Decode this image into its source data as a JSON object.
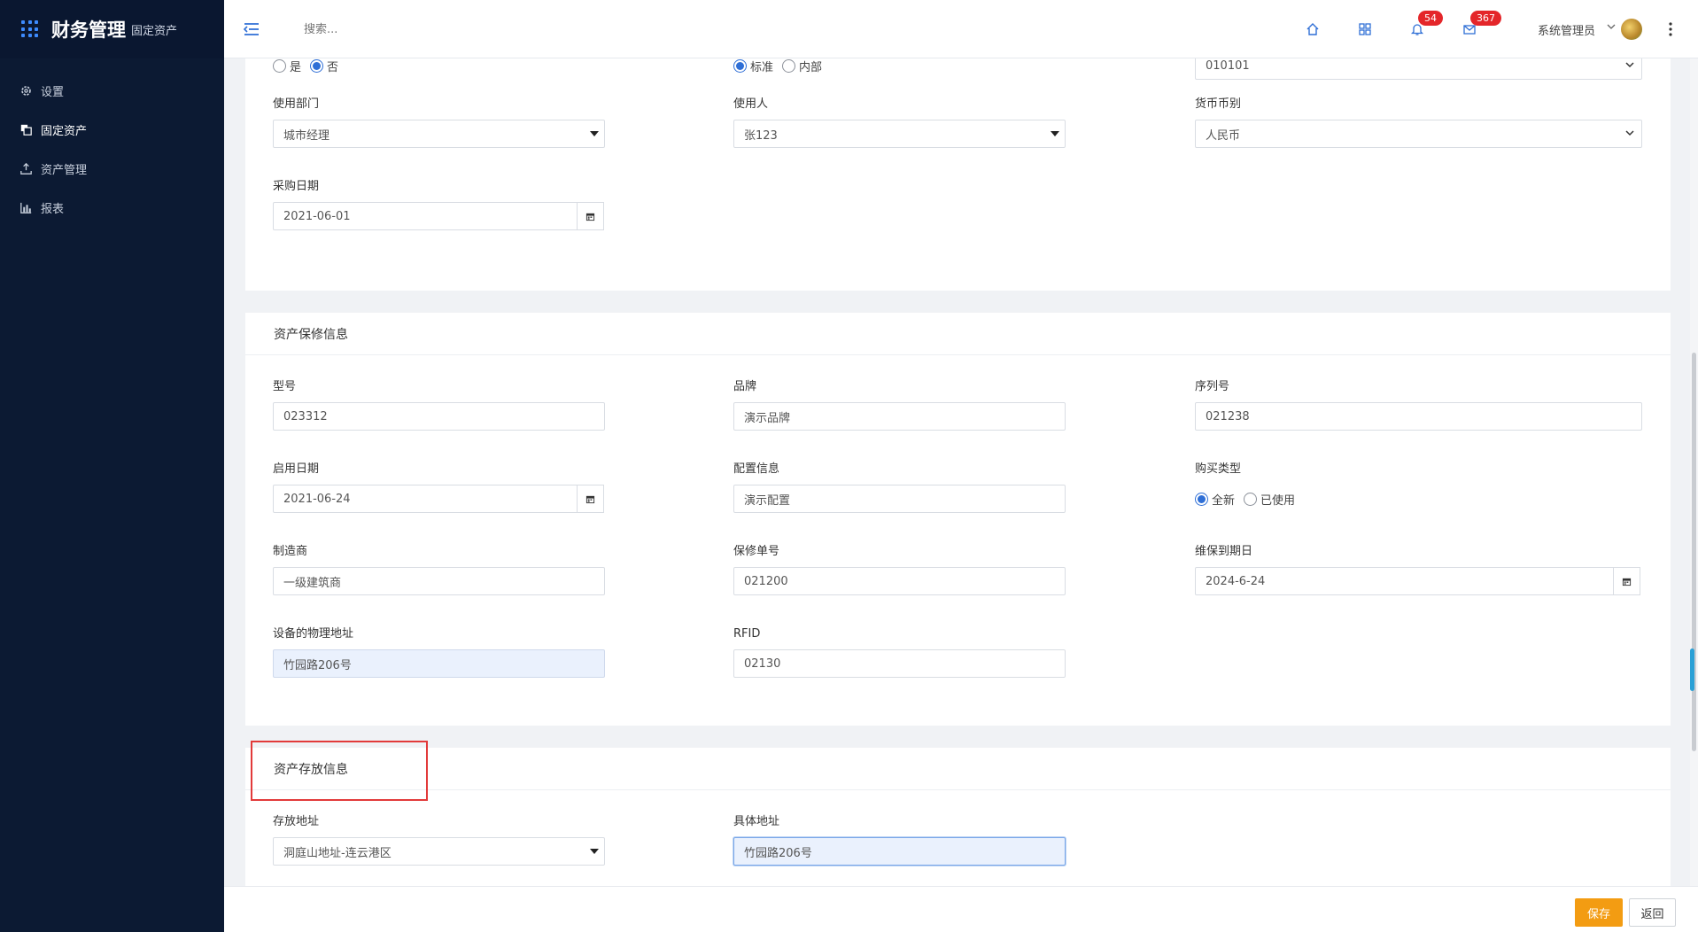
{
  "brand": {
    "title": "财务管理",
    "subtitle": "固定资产"
  },
  "sidebar": {
    "items": [
      {
        "label": "设置",
        "icon": "gear-icon"
      },
      {
        "label": "固定资产",
        "icon": "copy-icon"
      },
      {
        "label": "资产管理",
        "icon": "upload-icon"
      },
      {
        "label": "报表",
        "icon": "bar-chart-icon"
      }
    ]
  },
  "topbar": {
    "search_placeholder": "搜索...",
    "notifications_count": "54",
    "messages_count": "367",
    "user_name": "系统管理员"
  },
  "section1": {
    "row0": {
      "radio1": {
        "options": [
          "是",
          "否"
        ],
        "selected": 1
      },
      "radio2": {
        "options": [
          "标准",
          "内部"
        ],
        "selected": 0
      },
      "code_value": "010101"
    },
    "department": {
      "label": "使用部门",
      "value": "城市经理"
    },
    "user": {
      "label": "使用人",
      "value": "张123"
    },
    "currency": {
      "label": "货币币别",
      "value": "人民币"
    },
    "purchase_date": {
      "label": "采购日期",
      "value": "2021-06-01"
    }
  },
  "warranty": {
    "title": "资产保修信息",
    "model": {
      "label": "型号",
      "value": "023312"
    },
    "brand": {
      "label": "品牌",
      "value": "演示品牌"
    },
    "serial": {
      "label": "序列号",
      "value": "021238"
    },
    "start_date": {
      "label": "启用日期",
      "value": "2021-06-24"
    },
    "config": {
      "label": "配置信息",
      "value": "演示配置"
    },
    "purchase_type": {
      "label": "购买类型",
      "options": [
        "全新",
        "已使用"
      ],
      "selected": 0
    },
    "manufacturer": {
      "label": "制造商",
      "value": "一级建筑商"
    },
    "warranty_no": {
      "label": "保修单号",
      "value": "021200"
    },
    "expire_date": {
      "label": "维保到期日",
      "value": "2024-6-24"
    },
    "physical_address": {
      "label": "设备的物理地址",
      "value": "竹园路206号"
    },
    "rfid": {
      "label": "RFID",
      "value": "02130"
    }
  },
  "storage": {
    "title": "资产存放信息",
    "address": {
      "label": "存放地址",
      "value": "洞庭山地址-连云港区"
    },
    "detail_address": {
      "label": "具体地址",
      "value": "竹园路206号"
    }
  },
  "footer": {
    "save_label": "保存",
    "back_label": "返回"
  },
  "colors": {
    "sidebar_bg": "#0c1a33",
    "accent": "#2f6fd6",
    "save": "#f39c12",
    "badge": "#e4262a",
    "highlight": "#e23a3a"
  }
}
